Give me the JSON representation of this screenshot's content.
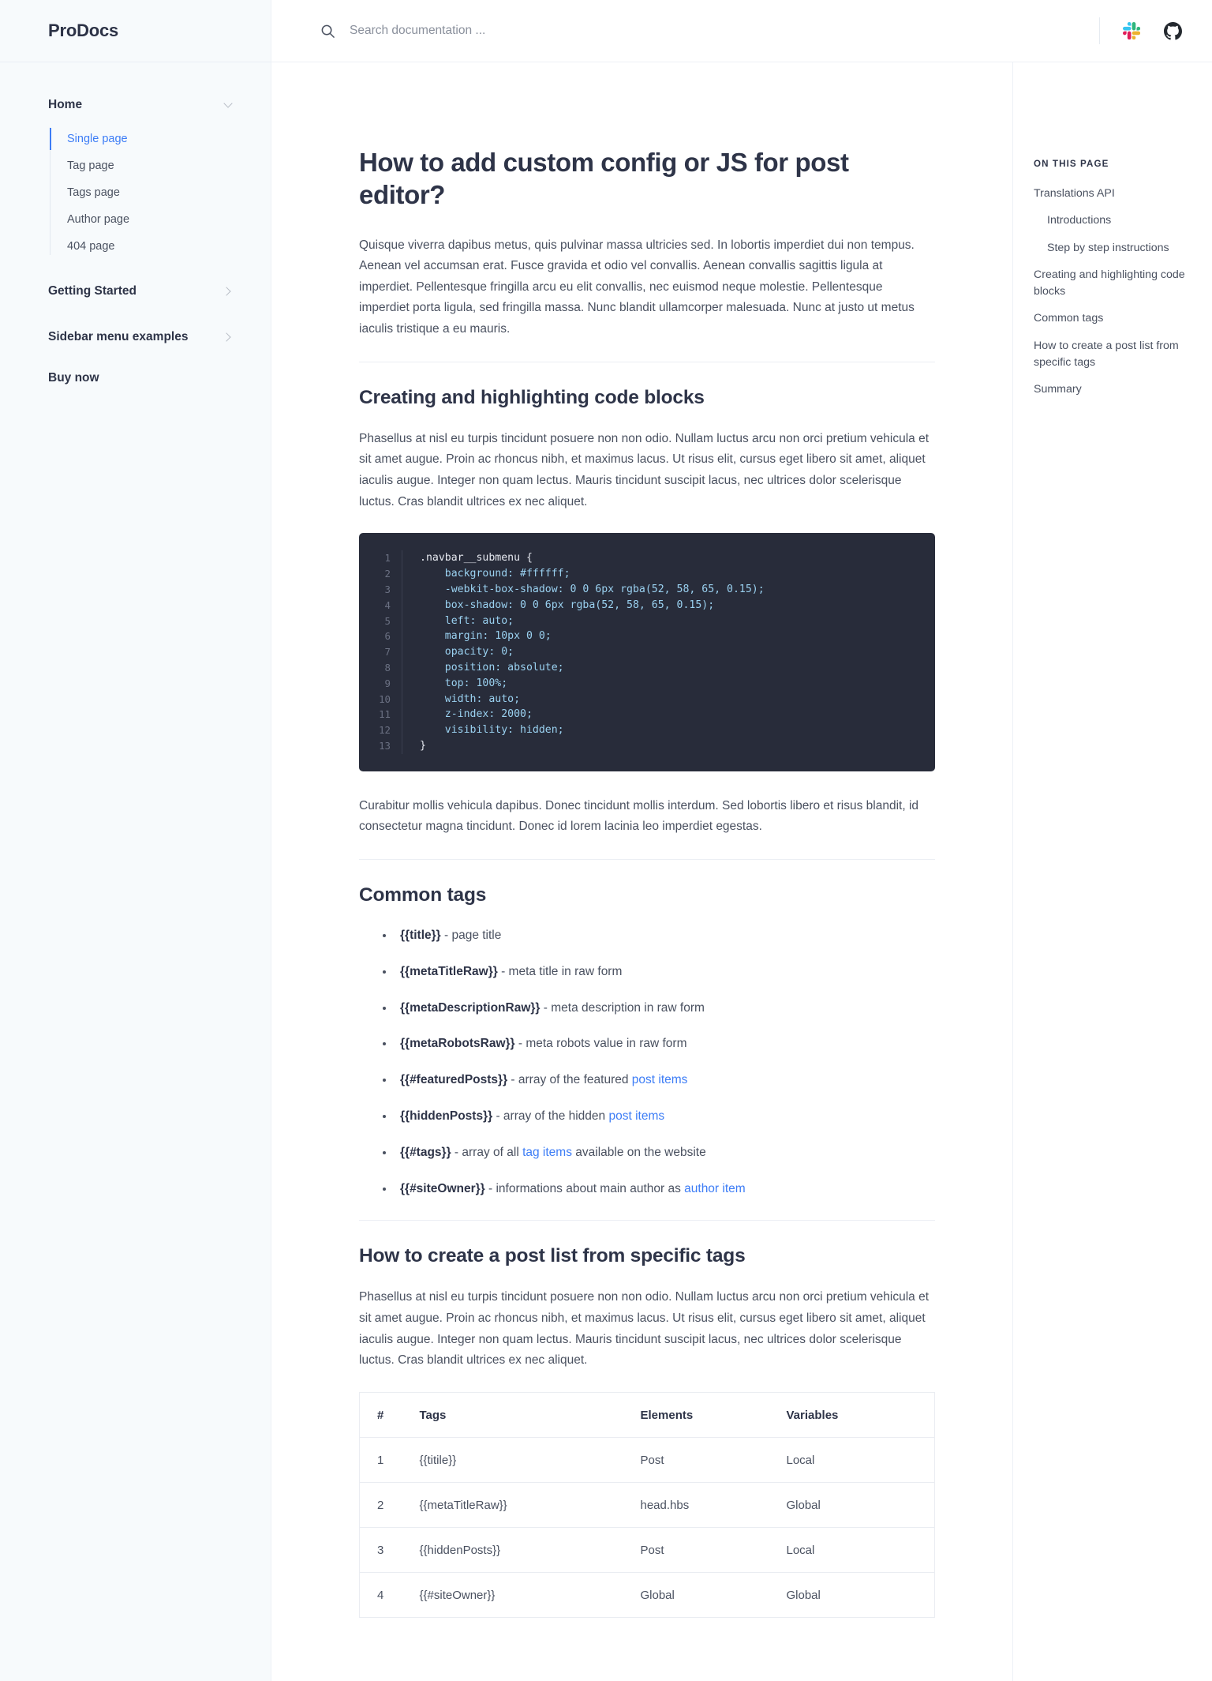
{
  "brand": {
    "name": "ProDocs"
  },
  "search": {
    "placeholder": "Search documentation ...",
    "value": "",
    "icon": "search-icon"
  },
  "topbar_actions": [
    {
      "icon": "slack-icon",
      "label": "Slack"
    },
    {
      "icon": "github-icon",
      "label": "GitHub"
    }
  ],
  "sidebar": {
    "groups": [
      {
        "label": "Home",
        "icon": "chevron-down-icon",
        "expanded": true,
        "items": [
          {
            "label": "Single page",
            "active": true
          },
          {
            "label": "Tag page",
            "active": false
          },
          {
            "label": "Tags page",
            "active": false
          },
          {
            "label": "Author page",
            "active": false
          },
          {
            "label": "404 page",
            "active": false
          }
        ]
      },
      {
        "label": "Getting Started",
        "icon": "chevron-right-icon",
        "expanded": false,
        "items": []
      },
      {
        "label": "Sidebar menu examples",
        "icon": "chevron-right-icon",
        "expanded": false,
        "items": []
      }
    ],
    "flat_items": [
      {
        "label": "Buy now"
      }
    ]
  },
  "article": {
    "title": "How to add custom config or JS for post editor?",
    "intro": "Quisque viverra dapibus metus, quis pulvinar massa ultricies sed. In lobortis imperdiet dui non tempus. Aenean vel accumsan erat. Fusce gravida et odio vel convallis. Aenean convallis sagittis ligula at imperdiet. Pellentesque fringilla arcu eu elit convallis, nec euismod neque molestie. Pellentesque imperdiet porta ligula, sed fringilla massa. Nunc blandit ullamcorper malesuada. Nunc at justo ut metus iaculis tristique a eu mauris.",
    "section_code": {
      "heading": "Creating and highlighting code blocks",
      "paragraph": "Phasellus at nisl eu turpis tincidunt posuere non non odio. Nullam luctus arcu non orci pretium vehicula et sit amet augue. Proin ac rhoncus nibh, et maximus lacus. Ut risus elit, cursus eget libero sit amet, aliquet iaculis augue. Integer non quam lectus. Mauris tincidunt suscipit lacus, nec ultrices dolor scelerisque luctus. Cras blandit ultrices ex nec aliquet.",
      "after_paragraph": "Curabitur mollis vehicula dapibus. Donec tincidunt mollis interdum. Sed lobortis libero et risus blandit, id consectetur magna tincidunt. Donec id lorem lacinia leo imperdiet egestas.",
      "code_lines": [
        {
          "n": "1",
          "text": ".navbar__submenu {"
        },
        {
          "n": "2",
          "text": "    background: #ffffff;"
        },
        {
          "n": "3",
          "text": "    -webkit-box-shadow: 0 0 6px rgba(52, 58, 65, 0.15);"
        },
        {
          "n": "4",
          "text": "    box-shadow: 0 0 6px rgba(52, 58, 65, 0.15);"
        },
        {
          "n": "5",
          "text": "    left: auto;"
        },
        {
          "n": "6",
          "text": "    margin: 10px 0 0;"
        },
        {
          "n": "7",
          "text": "    opacity: 0;"
        },
        {
          "n": "8",
          "text": "    position: absolute;"
        },
        {
          "n": "9",
          "text": "    top: 100%;"
        },
        {
          "n": "10",
          "text": "    width: auto;"
        },
        {
          "n": "11",
          "text": "    z-index: 2000;"
        },
        {
          "n": "12",
          "text": "    visibility: hidden;"
        },
        {
          "n": "13",
          "text": "}"
        }
      ]
    },
    "section_tags": {
      "heading": "Common tags",
      "items": [
        {
          "tag": "{{title}}",
          "desc": " - page title",
          "link": "",
          "desc_after": ""
        },
        {
          "tag": "{{metaTitleRaw}}",
          "desc": " - meta title in raw form",
          "link": "",
          "desc_after": ""
        },
        {
          "tag": "{{metaDescriptionRaw}}",
          "desc": " - meta description in raw form",
          "link": "",
          "desc_after": ""
        },
        {
          "tag": "{{metaRobotsRaw}}",
          "desc": " - meta robots value in raw form",
          "link": "",
          "desc_after": ""
        },
        {
          "tag": "{{#featuredPosts}}",
          "desc": " - array of the featured ",
          "link": "post items",
          "desc_after": ""
        },
        {
          "tag": "{{hiddenPosts}}",
          "desc": " - array of the hidden ",
          "link": "post items",
          "desc_after": ""
        },
        {
          "tag": "{{#tags}}",
          "desc": " - array of all ",
          "link": "tag items",
          "desc_after": " available on the website"
        },
        {
          "tag": "{{#siteOwner}}",
          "desc": " - informations about main author as ",
          "link": "author item",
          "desc_after": ""
        }
      ]
    },
    "section_postlist": {
      "heading": "How to create a post list from specific tags",
      "paragraph": "Phasellus at nisl eu turpis tincidunt posuere non non odio. Nullam luctus arcu non orci pretium vehicula et sit amet augue. Proin ac rhoncus nibh, et maximus lacus. Ut risus elit, cursus eget libero sit amet, aliquet iaculis augue. Integer non quam lectus. Mauris tincidunt suscipit lacus, nec ultrices dolor scelerisque luctus. Cras blandit ultrices ex nec aliquet.",
      "table": {
        "columns": [
          "#",
          "Tags",
          "Elements",
          "Variables"
        ],
        "rows": [
          {
            "num": "1",
            "tags": "{{titile}}",
            "elements": "Post",
            "variables": "Local"
          },
          {
            "num": "2",
            "tags": "{{metaTitleRaw}}",
            "elements": "head.hbs",
            "variables": "Global"
          },
          {
            "num": "3",
            "tags": "{{hiddenPosts}}",
            "elements": "Post",
            "variables": "Local"
          },
          {
            "num": "4",
            "tags": "{{#siteOwner}}",
            "elements": "Global",
            "variables": "Global"
          }
        ]
      }
    }
  },
  "toc": {
    "title": "ON THIS PAGE",
    "items": [
      {
        "label": "Translations API",
        "level": 1
      },
      {
        "label": "Introductions",
        "level": 2
      },
      {
        "label": "Step by step instructions",
        "level": 2
      },
      {
        "label": "Creating and highlighting code blocks",
        "level": 1
      },
      {
        "label": "Common tags",
        "level": 1
      },
      {
        "label": "How to create a post list from specific tags",
        "level": 1
      },
      {
        "label": "Summary",
        "level": 1
      }
    ]
  },
  "colors": {
    "accent": "#3d7df6",
    "heading": "#2e3448",
    "body": "#4a5160",
    "sidebar_bg": "#f7fafc",
    "code_bg": "#282c3a"
  }
}
